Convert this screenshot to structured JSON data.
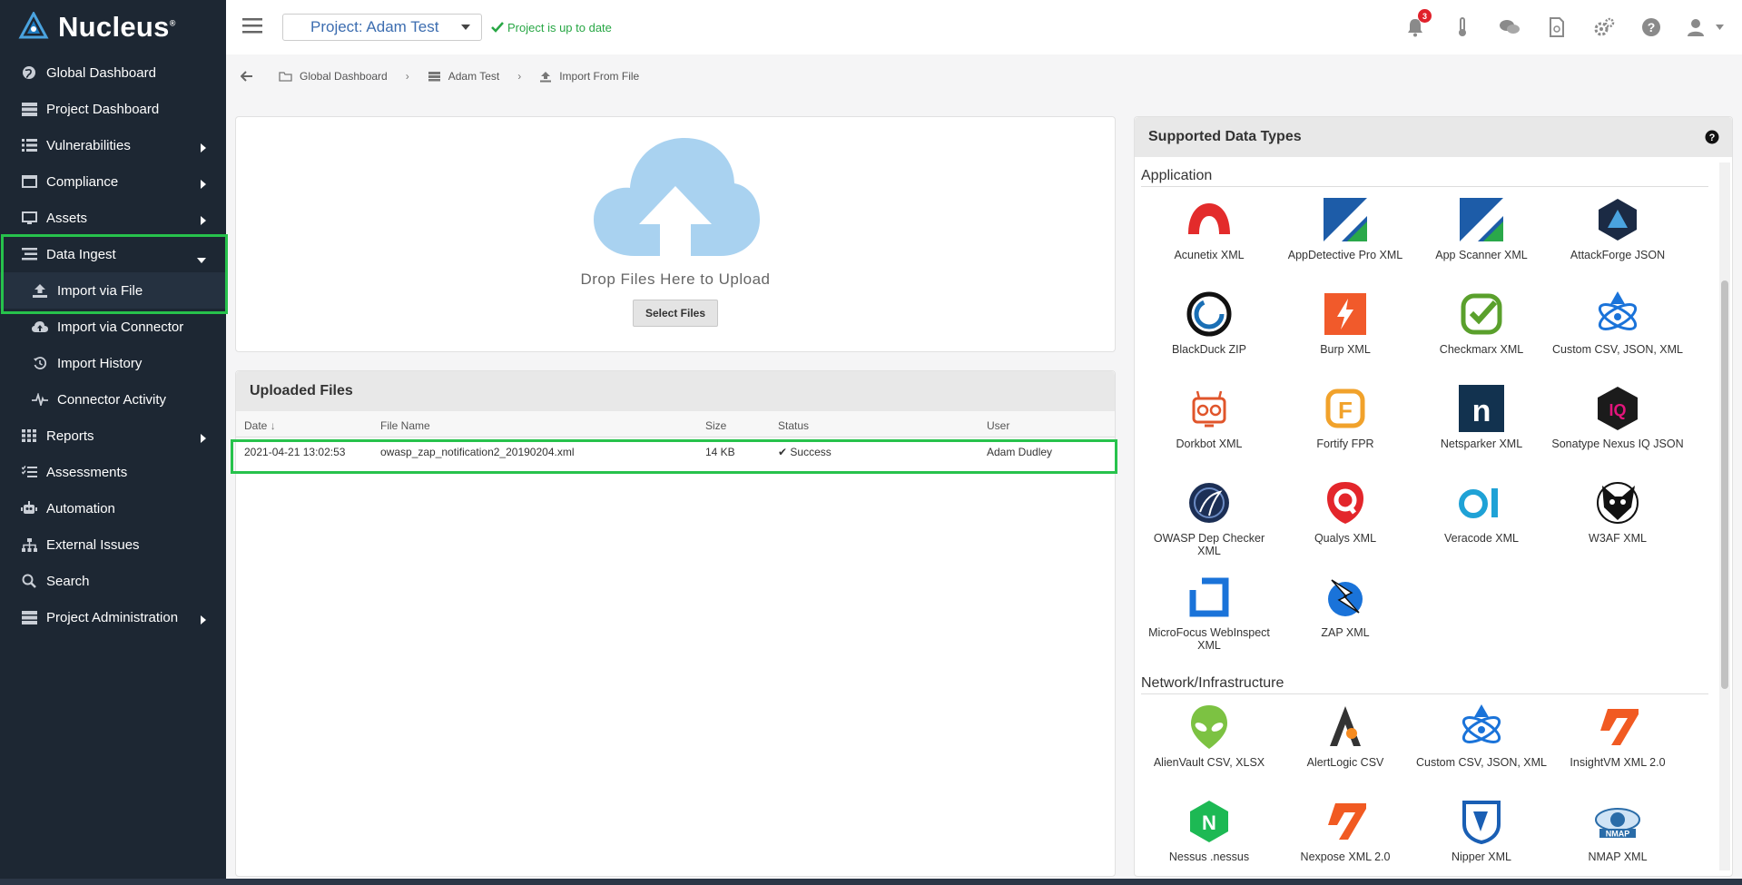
{
  "app": {
    "name": "Nucleus",
    "trademark": "®"
  },
  "sidebar": {
    "items": [
      {
        "label": "Global Dashboard",
        "icon": "globe-icon"
      },
      {
        "label": "Project Dashboard",
        "icon": "server-icon"
      },
      {
        "label": "Vulnerabilities",
        "icon": "list-icon",
        "has_arrow": true
      },
      {
        "label": "Compliance",
        "icon": "window-icon",
        "has_arrow": true
      },
      {
        "label": "Assets",
        "icon": "desktop-icon",
        "has_arrow": true
      },
      {
        "label": "Data Ingest",
        "icon": "bars-icon",
        "expanded": true
      },
      {
        "label": "Import via File",
        "icon": "upload-icon",
        "sub": true,
        "active": true
      },
      {
        "label": "Import via Connector",
        "icon": "cloud-upload-icon",
        "sub": true
      },
      {
        "label": "Import History",
        "icon": "history-icon",
        "sub": true
      },
      {
        "label": "Connector Activity",
        "icon": "pulse-icon",
        "sub": true
      },
      {
        "label": "Reports",
        "icon": "grid-icon",
        "has_arrow": true
      },
      {
        "label": "Assessments",
        "icon": "checklist-icon"
      },
      {
        "label": "Automation",
        "icon": "robot-icon"
      },
      {
        "label": "External Issues",
        "icon": "sitemap-icon"
      },
      {
        "label": "Search",
        "icon": "search-icon"
      },
      {
        "label": "Project Administration",
        "icon": "server-icon",
        "has_arrow": true
      }
    ]
  },
  "topbar": {
    "project_label": "Project: Adam Test",
    "status": "Project is up to date",
    "notification_count": "3"
  },
  "breadcrumb": {
    "items": [
      "Global Dashboard",
      "Adam Test",
      "Import From File"
    ]
  },
  "upload": {
    "drop_text": "Drop Files Here to Upload",
    "select_label": "Select Files"
  },
  "uploaded": {
    "title": "Uploaded Files",
    "columns": [
      "Date",
      "File Name",
      "Size",
      "Status",
      "User"
    ],
    "rows": [
      {
        "date": "2021-04-21 13:02:53",
        "file": "owasp_zap_notification2_20190204.xml",
        "size": "14 KB",
        "status": "Success",
        "user": "Adam Dudley"
      }
    ]
  },
  "types": {
    "title": "Supported Data Types",
    "groups": [
      {
        "name": "Application",
        "items": [
          {
            "label": "Acunetix XML",
            "color": "#e32b2b"
          },
          {
            "label": "AppDetective Pro XML",
            "color": "#1d5ca8"
          },
          {
            "label": "App Scanner XML",
            "color": "#1d5ca8"
          },
          {
            "label": "AttackForge JSON",
            "color": "#1b2a44"
          },
          {
            "label": "BlackDuck ZIP",
            "color": "#1a6fb5"
          },
          {
            "label": "Burp XML",
            "color": "#f15a2b"
          },
          {
            "label": "Checkmarx XML",
            "color": "#5aa02c"
          },
          {
            "label": "Custom CSV, JSON, XML",
            "color": "#1a73d9"
          },
          {
            "label": "Dorkbot XML",
            "color": "#e0552b"
          },
          {
            "label": "Fortify FPR",
            "color": "#f1a22b"
          },
          {
            "label": "Netsparker XML",
            "color": "#12324f"
          },
          {
            "label": "Sonatype Nexus IQ JSON",
            "color": "#e3157c"
          },
          {
            "label": "OWASP Dep Checker XML",
            "color": "#1c2f55"
          },
          {
            "label": "Qualys XML",
            "color": "#e3262b"
          },
          {
            "label": "Veracode XML",
            "color": "#1fa2d6"
          },
          {
            "label": "W3AF XML",
            "color": "#111111"
          },
          {
            "label": "MicroFocus WebInspect XML",
            "color": "#1a73d9"
          },
          {
            "label": "ZAP XML",
            "color": "#1a73d9"
          }
        ]
      },
      {
        "name": "Network/Infrastructure",
        "items": [
          {
            "label": "AlienVault CSV, XLSX",
            "color": "#7cc242"
          },
          {
            "label": "AlertLogic CSV",
            "color": "#333333"
          },
          {
            "label": "Custom CSV, JSON, XML",
            "color": "#1a73d9"
          },
          {
            "label": "InsightVM XML 2.0",
            "color": "#f15a22"
          },
          {
            "label": "Nessus .nessus",
            "color": "#1db954"
          },
          {
            "label": "Nexpose XML 2.0",
            "color": "#f15a22"
          },
          {
            "label": "Nipper XML",
            "color": "#1a5fb4"
          },
          {
            "label": "NMAP XML",
            "color": "#2a6ca8"
          }
        ]
      }
    ]
  }
}
